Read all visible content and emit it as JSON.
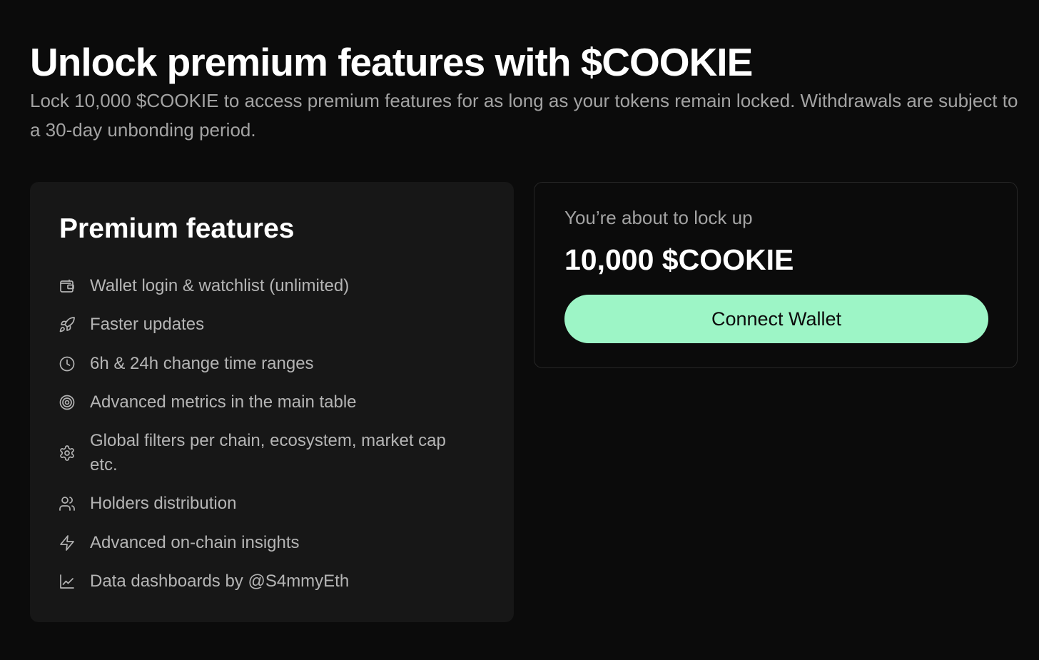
{
  "header": {
    "title": "Unlock premium features with $COOKIE",
    "subtitle": "Lock 10,000 $COOKIE to access premium features for as long as your tokens remain locked. Withdrawals are subject to a 30-day unbonding period."
  },
  "features": {
    "title": "Premium features",
    "items": [
      {
        "icon": "wallet-icon",
        "label": "Wallet login & watchlist (unlimited)"
      },
      {
        "icon": "rocket-icon",
        "label": "Faster updates"
      },
      {
        "icon": "clock-icon",
        "label": "6h & 24h change time ranges"
      },
      {
        "icon": "target-icon",
        "label": "Advanced metrics in the main table"
      },
      {
        "icon": "gear-icon",
        "label": "Global filters per chain, ecosystem, market cap etc."
      },
      {
        "icon": "users-icon",
        "label": "Holders distribution"
      },
      {
        "icon": "lightning-icon",
        "label": "Advanced on-chain insights"
      },
      {
        "icon": "line-chart-icon",
        "label": "Data dashboards by @S4mmyEth"
      }
    ]
  },
  "lock": {
    "caption": "You’re about to lock up",
    "amount": "10,000 $COOKIE",
    "button_label": "Connect Wallet"
  },
  "colors": {
    "background": "#0b0b0b",
    "card": "#171717",
    "accent": "#9df5c6",
    "muted_text": "#a3a3a3"
  }
}
